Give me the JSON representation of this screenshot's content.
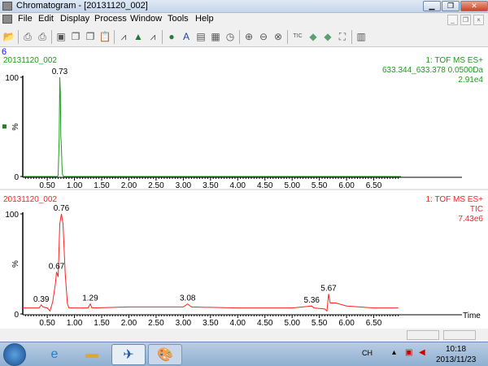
{
  "window": {
    "title": "Chromatogram - [20131120_002]",
    "minimize": "▁",
    "restore": "❐",
    "close": "✕"
  },
  "menu": [
    "File",
    "Edit",
    "Display",
    "Process",
    "Window",
    "Tools",
    "Help"
  ],
  "toolbar": {
    "icons": [
      "open-icon",
      "print-icon",
      "print-preview-icon",
      "camera-icon",
      "copy-icon",
      "copy-list-icon",
      "paste-icon",
      "chromatogram-icon",
      "peak-icon",
      "integrate-icon",
      "globe-icon",
      "text-icon",
      "combine-icon",
      "list-icon",
      "timer-icon",
      "zoom-in-icon",
      "zoom-out-icon",
      "zoom-reset-icon",
      "tic-icon",
      "back-icon",
      "forward-icon",
      "fit-icon",
      "settings-icon"
    ],
    "tic_label": "TIC",
    "text_label": "A"
  },
  "panel_count": "6",
  "chart_data": [
    {
      "type": "line",
      "sample": "20131120_002",
      "title_lines": [
        "1: TOF MS ES+",
        "633.344_633.378 0.0500Da",
        "2.91e4"
      ],
      "color": "#1f9a1f",
      "ylabel": "%",
      "xlim": [
        0.05,
        7.0
      ],
      "ylim": [
        0,
        100
      ],
      "yticks": [
        "0",
        "100"
      ],
      "xticks": [
        "0.50",
        "1.00",
        "1.50",
        "2.00",
        "2.50",
        "3.00",
        "3.50",
        "4.00",
        "4.50",
        "5.00",
        "5.50",
        "6.00",
        "6.50"
      ],
      "x": [
        0.05,
        0.68,
        0.7,
        0.72,
        0.73,
        0.74,
        0.75,
        0.76,
        0.77,
        0.78,
        0.8,
        7.0
      ],
      "y": [
        0,
        0,
        1,
        40,
        100,
        85,
        40,
        30,
        10,
        2,
        0,
        0
      ],
      "peak_labels": [
        {
          "t": 0.73,
          "label": "0.73",
          "y": 100
        }
      ]
    },
    {
      "type": "line",
      "sample": "20131120_002",
      "title_lines": [
        "1: TOF MS ES+",
        "TIC",
        "7.43e6"
      ],
      "color": "#ff2020",
      "ylabel": "%",
      "xlabel": "Time",
      "xlim": [
        0.05,
        7.0
      ],
      "ylim": [
        0,
        100
      ],
      "yticks": [
        "0",
        "100"
      ],
      "xticks": [
        "0.50",
        "1.00",
        "1.50",
        "2.00",
        "2.50",
        "3.00",
        "3.50",
        "4.00",
        "4.50",
        "5.00",
        "5.50",
        "6.00",
        "6.50"
      ],
      "x": [
        0.05,
        0.35,
        0.39,
        0.42,
        0.5,
        0.55,
        0.6,
        0.65,
        0.67,
        0.7,
        0.73,
        0.76,
        0.79,
        0.83,
        0.87,
        0.9,
        1.25,
        1.29,
        1.32,
        2.0,
        3.0,
        3.08,
        3.15,
        4.0,
        5.0,
        5.36,
        5.4,
        5.6,
        5.64,
        5.67,
        5.7,
        5.8,
        6.0,
        6.5,
        6.95
      ],
      "y": [
        6,
        6,
        9,
        7,
        6,
        3,
        12,
        30,
        42,
        37,
        90,
        100,
        90,
        40,
        10,
        6,
        6,
        10,
        6,
        7,
        7,
        10,
        7,
        6,
        6,
        8,
        6,
        5,
        3,
        20,
        11,
        11,
        8,
        6,
        6
      ],
      "peak_labels": [
        {
          "t": 0.39,
          "label": "0.39",
          "y": 9
        },
        {
          "t": 0.67,
          "label": "0.67",
          "y": 42
        },
        {
          "t": 0.76,
          "label": "0.76",
          "y": 100
        },
        {
          "t": 1.29,
          "label": "1.29",
          "y": 10
        },
        {
          "t": 3.08,
          "label": "3.08",
          "y": 10
        },
        {
          "t": 5.36,
          "label": "5.36",
          "y": 8
        },
        {
          "t": 5.67,
          "label": "5.67",
          "y": 20
        }
      ]
    }
  ],
  "taskbar": {
    "lang": "CH",
    "time": "10:18",
    "date": "2013/11/23"
  }
}
